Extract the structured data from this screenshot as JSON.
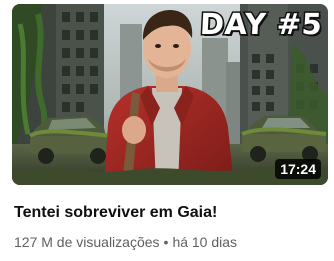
{
  "video": {
    "thumbnail_overlay_text": "DAY #5",
    "duration": "17:24",
    "title": "Tentei sobreviver em Gaia!",
    "views": "127 M de visualizações",
    "separator": "•",
    "age": "há 10 dias"
  },
  "colors": {
    "title_text": "#0f0f0f",
    "meta_text": "#606060",
    "duration_badge_bg": "#000000",
    "overlay_text": "#ffffff"
  }
}
